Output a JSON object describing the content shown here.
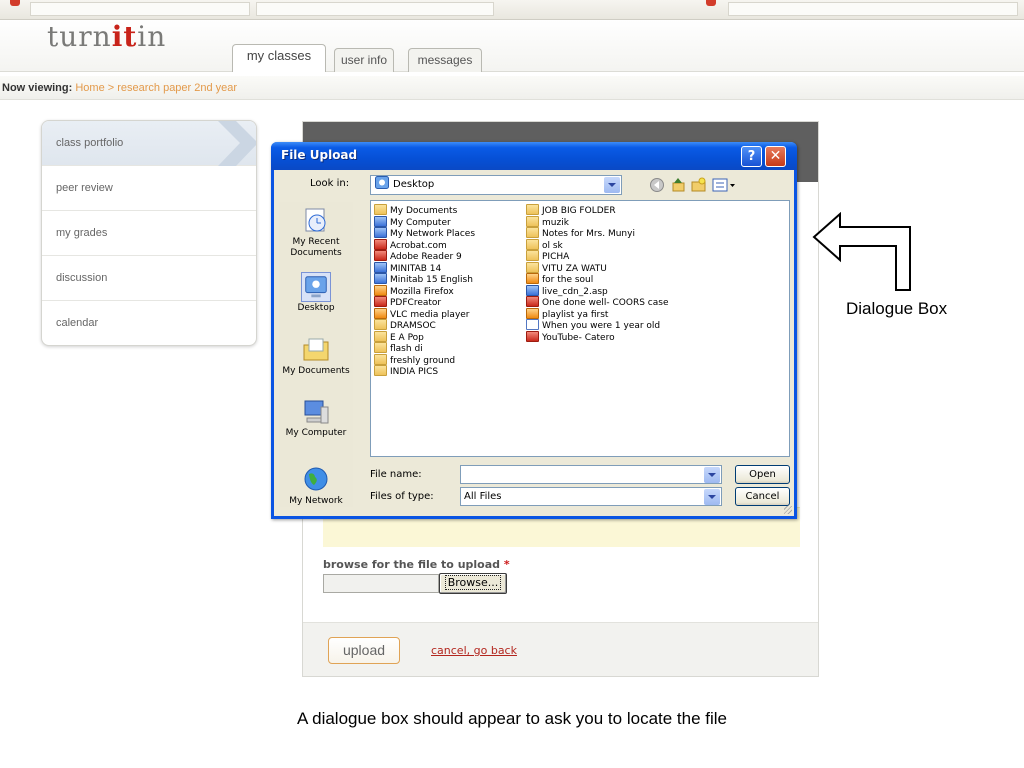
{
  "header": {
    "logo_prefix": "turn",
    "logo_highlight": "it",
    "logo_suffix": "in",
    "tabs": [
      {
        "label": "my classes",
        "active": true
      },
      {
        "label": "user info",
        "active": false
      },
      {
        "label": "messages",
        "active": false
      }
    ]
  },
  "breadcrumb": {
    "label": "Now viewing:",
    "path": "Home > research paper 2nd year"
  },
  "sidebar": {
    "items": [
      {
        "label": "class portfolio",
        "active": true
      },
      {
        "label": "peer review"
      },
      {
        "label": "my grades"
      },
      {
        "label": "discussion"
      },
      {
        "label": "calendar"
      }
    ]
  },
  "upload_form": {
    "browse_label": "browse for the file to upload",
    "required_mark": "*",
    "browse_button": "Browse...",
    "upload_button": "upload",
    "cancel_link": "cancel, go back"
  },
  "dialog": {
    "title": "File Upload",
    "help_glyph": "?",
    "close_glyph": "✕",
    "look_in_label": "Look in:",
    "look_in_value": "Desktop",
    "places": [
      {
        "label": "My Recent Documents",
        "icon": "recent-documents-icon"
      },
      {
        "label": "Desktop",
        "icon": "desktop-icon",
        "selected": true
      },
      {
        "label": "My Documents",
        "icon": "my-documents-icon"
      },
      {
        "label": "My Computer",
        "icon": "my-computer-icon"
      },
      {
        "label": "My Network",
        "icon": "my-network-icon"
      }
    ],
    "files_col1": [
      {
        "name": "My Documents",
        "icon": "folder"
      },
      {
        "name": "My Computer",
        "icon": "blue"
      },
      {
        "name": "My Network Places",
        "icon": "blue"
      },
      {
        "name": "Acrobat.com",
        "icon": "red"
      },
      {
        "name": "Adobe Reader 9",
        "icon": "red"
      },
      {
        "name": "MINITAB 14",
        "icon": "blue"
      },
      {
        "name": "Minitab 15 English",
        "icon": "blue"
      },
      {
        "name": "Mozilla Firefox",
        "icon": "orange"
      },
      {
        "name": "PDFCreator",
        "icon": "red"
      },
      {
        "name": "VLC media player",
        "icon": "orange"
      },
      {
        "name": "DRAMSOC",
        "icon": "folder"
      },
      {
        "name": "E A Pop",
        "icon": "folder"
      },
      {
        "name": "flash di",
        "icon": "folder"
      },
      {
        "name": "freshly ground",
        "icon": "folder"
      },
      {
        "name": "INDIA PICS",
        "icon": "folder"
      }
    ],
    "files_col2": [
      {
        "name": "JOB BIG FOLDER",
        "icon": "folder"
      },
      {
        "name": "muzik",
        "icon": "folder"
      },
      {
        "name": "Notes for Mrs. Munyi",
        "icon": "folder"
      },
      {
        "name": "ol sk",
        "icon": "folder"
      },
      {
        "name": "PICHA",
        "icon": "folder"
      },
      {
        "name": "VITU ZA WATU",
        "icon": "folder"
      },
      {
        "name": "for the soul",
        "icon": "orange"
      },
      {
        "name": "live_cdn_2.asp",
        "icon": "blue"
      },
      {
        "name": "One done well- COORS case",
        "icon": "red"
      },
      {
        "name": "playlist ya first",
        "icon": "orange"
      },
      {
        "name": "When you were 1 year old",
        "icon": "doc"
      },
      {
        "name": "YouTube- Catero",
        "icon": "red"
      }
    ],
    "file_name_label": "File name:",
    "file_name_value": "",
    "file_type_label": "Files of type:",
    "file_type_value": "All Files",
    "open_button": "Open",
    "cancel_button": "Cancel"
  },
  "annotation": {
    "label": "Dialogue Box",
    "caption": "A dialogue box should appear to ask you to locate the file"
  },
  "colors": {
    "turnitin_red": "#c8231a",
    "breadcrumb_orange": "#e39a4b",
    "xp_title_blue": "#0a54e3",
    "cancel_link_red": "#b3261e"
  }
}
